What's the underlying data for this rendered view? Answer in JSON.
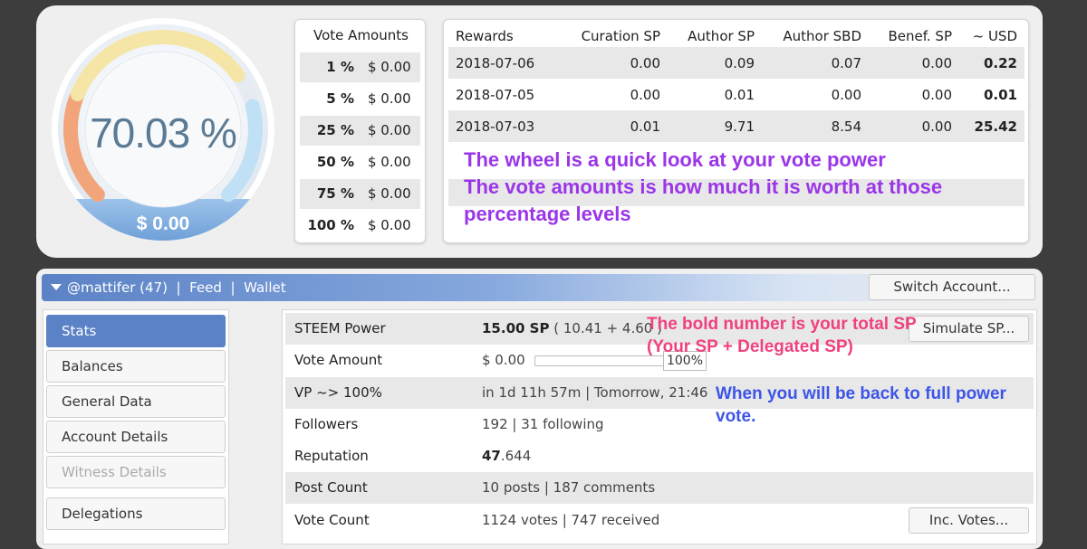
{
  "gauge": {
    "vote_power": "70.03 %",
    "vote_power_fraction": 0.7003,
    "vote_value": "$ 0.00",
    "colors": {
      "low": "#f2a57a",
      "mid": "#f5e6a8",
      "high": "#bfe0f5",
      "track": "#e6ebf1"
    }
  },
  "vote_amounts": {
    "header": "Vote Amounts",
    "rows": [
      {
        "pct": "1 %",
        "amount": "$ 0.00"
      },
      {
        "pct": "5 %",
        "amount": "$ 0.00"
      },
      {
        "pct": "25 %",
        "amount": "$ 0.00"
      },
      {
        "pct": "50 %",
        "amount": "$ 0.00"
      },
      {
        "pct": "75 %",
        "amount": "$ 0.00"
      },
      {
        "pct": "100 %",
        "amount": "$ 0.00"
      }
    ]
  },
  "rewards": {
    "headers": [
      "Rewards",
      "Curation SP",
      "Author SP",
      "Author SBD",
      "Benef. SP",
      "~ USD"
    ],
    "rows": [
      {
        "date": "2018-07-06",
        "curation_sp": "0.00",
        "author_sp": "0.09",
        "author_sbd": "0.07",
        "benef_sp": "0.00",
        "usd": "0.22"
      },
      {
        "date": "2018-07-05",
        "curation_sp": "0.00",
        "author_sp": "0.01",
        "author_sbd": "0.00",
        "benef_sp": "0.00",
        "usd": "0.01"
      },
      {
        "date": "2018-07-03",
        "curation_sp": "0.01",
        "author_sp": "9.71",
        "author_sbd": "8.54",
        "benef_sp": "0.00",
        "usd": "25.42"
      }
    ]
  },
  "annotations": {
    "wheel_line1": "The wheel is a quick look at your vote power",
    "wheel_line2": "The vote amounts is how much it is worth at those",
    "wheel_line3": "percentage levels",
    "sp_line1": "The bold number is your total SP",
    "sp_line2": "(Your SP + Delegated SP)",
    "vp_line1": "When you will be back to full power",
    "vp_line2": "vote.",
    "colors": {
      "purple": "#9b35e8",
      "pink": "#f0417f",
      "blue": "#3d55e8"
    }
  },
  "nav": {
    "account": "@mattifer (47)",
    "separator": "|",
    "feed": "Feed",
    "wallet": "Wallet",
    "switch_account": "Switch Account..."
  },
  "sidebar": {
    "items": [
      {
        "label": "Stats",
        "active": true
      },
      {
        "label": "Balances"
      },
      {
        "label": "General Data"
      },
      {
        "label": "Account Details"
      },
      {
        "label": "Witness Details",
        "disabled": true
      },
      {
        "label": "Delegations"
      }
    ],
    "accent": "#5b82c6"
  },
  "stats": {
    "steem_power": {
      "label": "STEEM Power",
      "total": "15.00 SP",
      "detail": "( 10.41 + 4.60 )",
      "button": "Simulate SP..."
    },
    "vote_amount": {
      "label": "Vote Amount",
      "value": "$ 0.00",
      "slider_pct": "100%",
      "slider_fraction": 1.0
    },
    "vp_full": {
      "label": "VP ~> 100%",
      "value": "in 1d 11h 57m | Tomorrow, 21:46"
    },
    "followers": {
      "label": "Followers",
      "value": "192 | 31 following"
    },
    "reputation": {
      "label": "Reputation",
      "int": "47",
      "dec": ".644"
    },
    "post_count": {
      "label": "Post Count",
      "value": "10 posts | 187 comments"
    },
    "vote_count": {
      "label": "Vote Count",
      "value": "1124 votes | 747 received",
      "button": "Inc. Votes..."
    }
  }
}
